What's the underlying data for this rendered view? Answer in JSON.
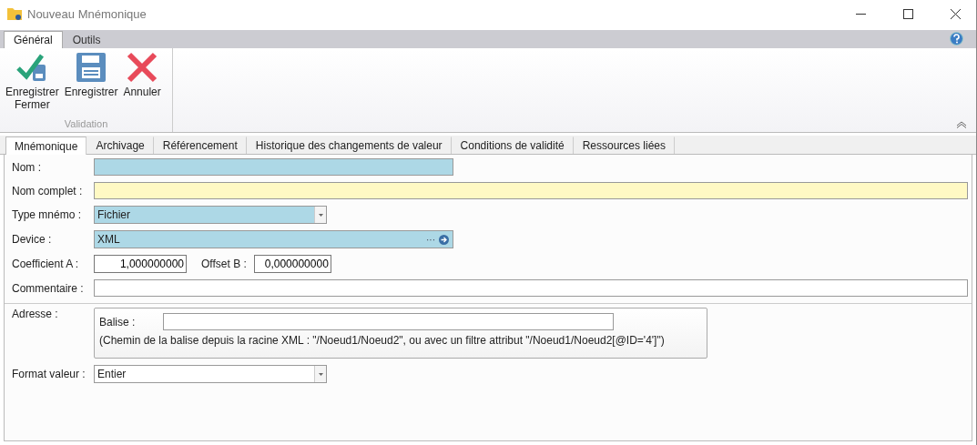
{
  "window": {
    "title": "Nouveau Mnémonique"
  },
  "ribbon_tabs": [
    {
      "label": "Général",
      "selected": true
    },
    {
      "label": "Outils",
      "selected": false
    }
  ],
  "ribbon_buttons": [
    {
      "kind": "save_close",
      "label": "Enregistrer\nFermer"
    },
    {
      "kind": "save",
      "label": "Enregistrer"
    },
    {
      "kind": "cancel",
      "label": "Annuler"
    }
  ],
  "ribbon_group": "Validation",
  "tabs": [
    {
      "label": "Mnémonique",
      "selected": true
    },
    {
      "label": "Archivage",
      "selected": false
    },
    {
      "label": "Référencement",
      "selected": false
    },
    {
      "label": "Historique des changements de valeur",
      "selected": false
    },
    {
      "label": "Conditions de validité",
      "selected": false
    },
    {
      "label": "Ressources liées",
      "selected": false
    }
  ],
  "rows": [
    {
      "kind": "field",
      "label": "Nom :",
      "color": "#add8e6"
    },
    {
      "kind": "wide_field",
      "label": "Nom complet :",
      "color": "#fff9c4"
    },
    {
      "kind": "combo",
      "label": "Type mnémo :",
      "value": "Fichier",
      "color": "#add8e6"
    },
    {
      "kind": "device",
      "label": "Device :",
      "value": "XML",
      "button": "···",
      "color": "#add8e6"
    },
    {
      "kind": "pair",
      "label": "Coefficient A :",
      "value": "1,000000000",
      "label2": "Offset B :",
      "value2": "0,000000000"
    },
    {
      "kind": "wide_field",
      "label": "Commentaire :",
      "color": "#ffffff"
    },
    {
      "kind": "address",
      "label": "Adresse :",
      "sublabel": "Balise :",
      "hint": "(Chemin de la balise depuis la racine XML : \"/Noeud1/Noeud2\", ou avec un filtre attribut \"/Noeud1/Noeud2[@ID='4']\")"
    },
    {
      "kind": "combo",
      "label": "Format valeur :",
      "value": "Entier",
      "color": "#ffffff"
    }
  ]
}
